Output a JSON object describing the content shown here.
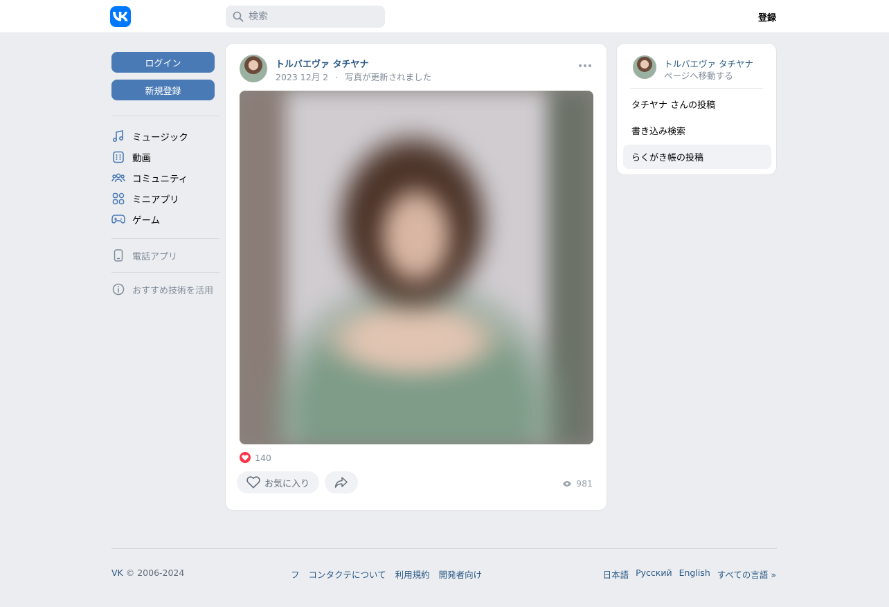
{
  "header": {
    "search_placeholder": "検索",
    "register_link": "登録"
  },
  "sidebar": {
    "login_button": "ログイン",
    "signup_button": "新規登録",
    "nav_items": [
      {
        "label": "ミュージック",
        "icon": "music-icon"
      },
      {
        "label": "動画",
        "icon": "video-icon"
      },
      {
        "label": "コミュニティ",
        "icon": "community-icon"
      },
      {
        "label": "ミニアプリ",
        "icon": "mini-apps-icon"
      },
      {
        "label": "ゲーム",
        "icon": "gamepad-icon"
      }
    ],
    "phone_app": "電話アプリ",
    "recommend_tech": "おすすめ技術を活用"
  },
  "post": {
    "author": "トルバエヴァ タチヤナ",
    "date": "2023 12月 2",
    "separator": "·",
    "action": "写真が更新されました",
    "likes_count": "140",
    "favorite_button": "お気に入り",
    "views_count": "981"
  },
  "profile_card": {
    "name": "トルバエヴァ タチヤナ",
    "go_to_page": "ページへ移動する",
    "items": [
      "タチヤナ さんの投稿",
      "書き込み検索",
      "らくがき帳の投稿"
    ]
  },
  "footer": {
    "brand": "VK",
    "copyright": "© 2006-2024",
    "links": [
      "フ",
      "コンタクテについて",
      "利用規約",
      "開発者向け"
    ],
    "languages": [
      "日本語",
      "Русский",
      "English",
      "すべての言語 »"
    ]
  },
  "colors": {
    "brand_blue": "#0077ff",
    "button_blue": "#4a7ab5",
    "link_blue": "#2a5885",
    "like_red": "#ff3347",
    "background": "#ebedf0"
  }
}
